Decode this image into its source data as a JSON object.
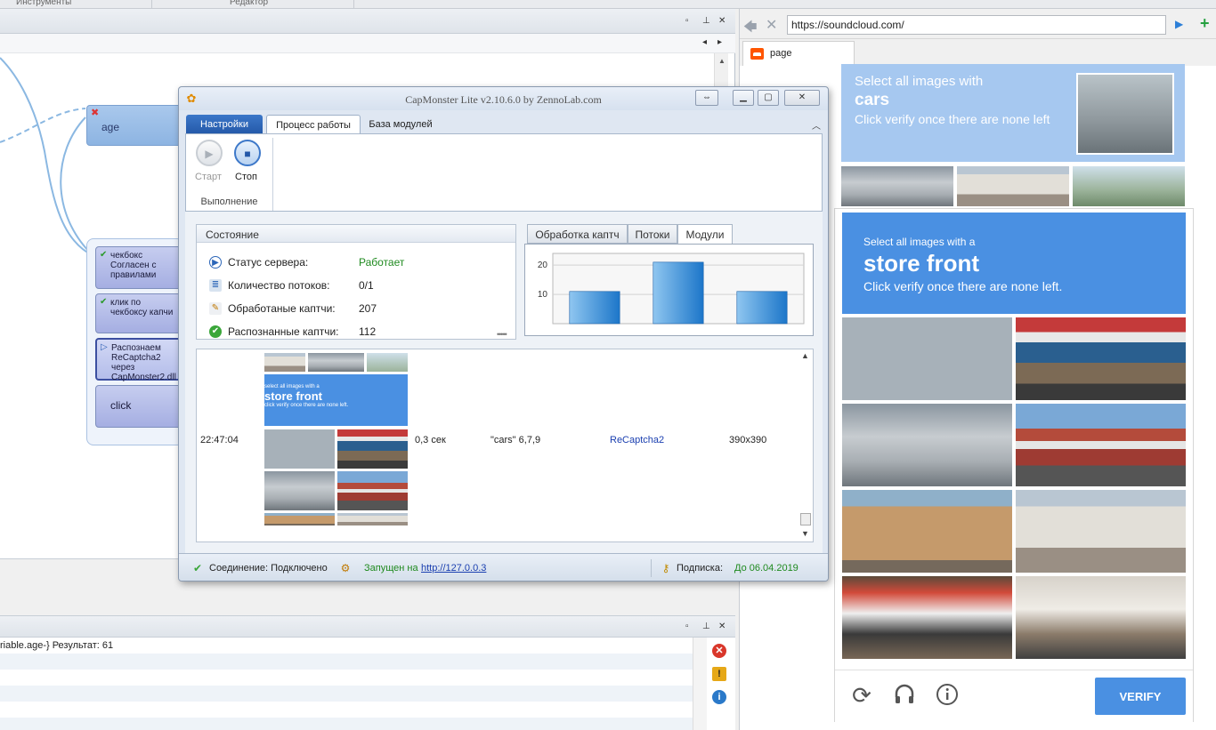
{
  "zenno": {
    "menu": {
      "tools": "Инструменты",
      "editor": "Редактор"
    },
    "nodes": {
      "age": "age",
      "checkbox": "чекбокс Согласен с правилами",
      "click_captcha": "клик по чекбоксу капчи",
      "recognize": "Распознаем ReCaptcha2 через CapMonster2.dll",
      "click": "click"
    },
    "log": {
      "row1": "riable.age-}  Результат: 61"
    }
  },
  "browser": {
    "url": "https://soundcloud.com/",
    "tab_label": "page"
  },
  "captcha_bg": {
    "line1": "Select all images with",
    "line2": "cars",
    "line3": "Click verify once there are none left"
  },
  "captcha": {
    "line1": "Select all images with a",
    "line2": "store front",
    "line3": "Click verify once there are none left.",
    "verify_label": "VERIFY"
  },
  "capmonster": {
    "title": "CapMonster Lite v2.10.6.0 by ZennoLab.com",
    "tabs": {
      "settings": "Настройки",
      "process": "Процесс работы",
      "modules": "База модулей"
    },
    "ribbon": {
      "start": "Старт",
      "stop": "Стоп",
      "group": "Выполнение"
    },
    "state": {
      "title": "Состояние",
      "rows": [
        {
          "label": "Статус сервера:",
          "value": "Работает",
          "color": "#1f8a1f"
        },
        {
          "label": "Количество потоков:",
          "value": "0/1",
          "color": "#222222"
        },
        {
          "label": "Обработаные каптчи:",
          "value": "207",
          "color": "#222222"
        },
        {
          "label": "Распознанные каптчи:",
          "value": "112",
          "color": "#222222"
        }
      ]
    },
    "chart_tabs": {
      "processing": "Обработка каптч",
      "threads": "Потоки",
      "modules": "Модули"
    },
    "table": {
      "time": "22:47:04",
      "duration": "0,3 сек",
      "answer": "\"cars\" 6,7,9",
      "type": "ReCaptcha2",
      "size": "390x390",
      "preview": {
        "line1": "select all images with a",
        "line2": "store front",
        "line3": "click verify once there are none left."
      }
    },
    "status": {
      "connection": "Соединение: Подключено",
      "launched_prefix": "Запущен на",
      "launched_url": "http://127.0.0.3",
      "subscription_label": "Подписка:",
      "subscription_value": "До 06.04.2019"
    },
    "colors": {
      "accent": "#2358a8",
      "ok": "#1f8a1f",
      "link": "#1a3fb0"
    }
  },
  "chart_data": {
    "type": "bar",
    "categories": [
      "",
      "",
      ""
    ],
    "values": [
      11,
      21,
      11
    ],
    "yticks": [
      "10",
      "20"
    ],
    "ylim": [
      0,
      24
    ]
  }
}
